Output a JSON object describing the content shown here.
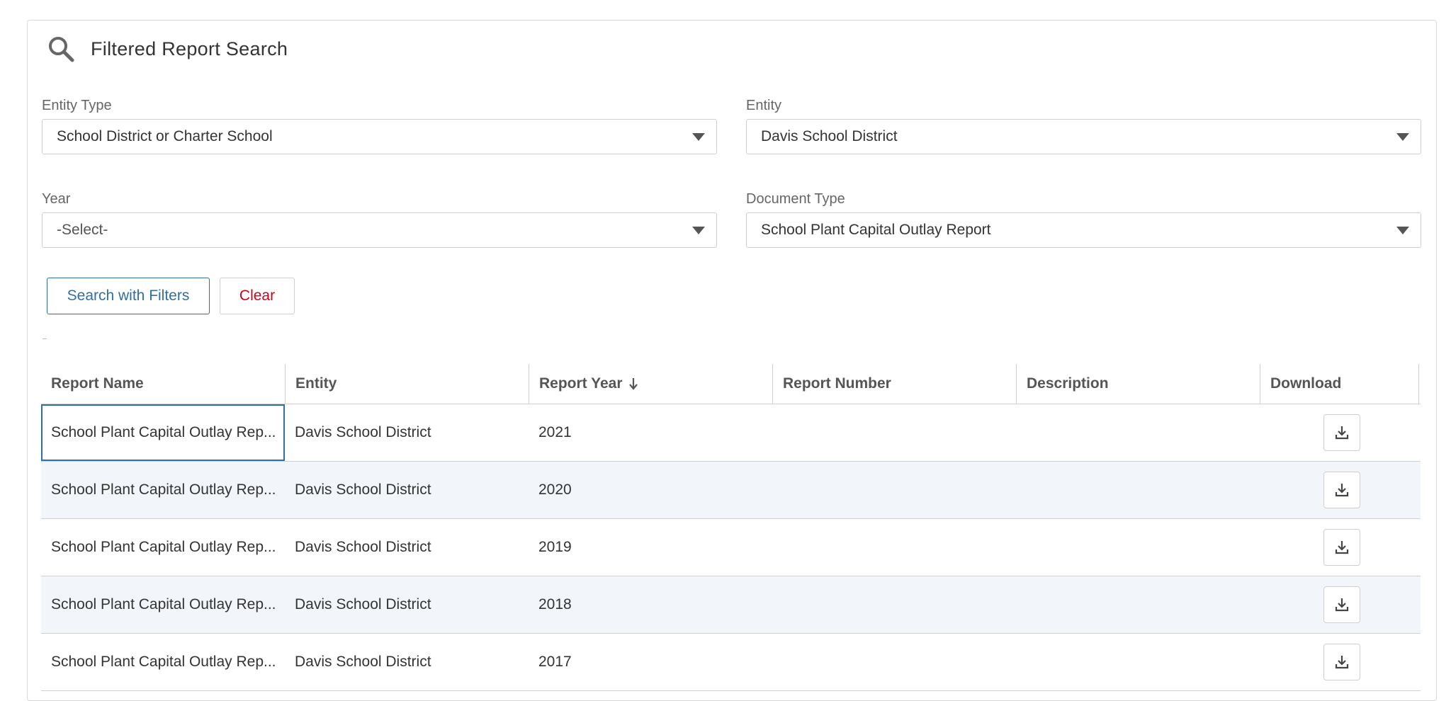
{
  "header": {
    "title": "Filtered Report Search",
    "icon": "search-icon"
  },
  "filters": {
    "entity_type": {
      "label": "Entity Type",
      "value": "School District or Charter School"
    },
    "entity": {
      "label": "Entity",
      "value": "Davis School District"
    },
    "year": {
      "label": "Year",
      "value": "-Select-"
    },
    "document_type": {
      "label": "Document Type",
      "value": "School Plant Capital Outlay Report"
    }
  },
  "buttons": {
    "search": "Search with Filters",
    "clear": "Clear"
  },
  "table": {
    "columns": [
      "Report Name",
      "Entity",
      "Report Year",
      "Report Number",
      "Description",
      "Download"
    ],
    "sort": {
      "column": "Report Year",
      "direction": "descending"
    },
    "rows": [
      {
        "name": "School Plant Capital Outlay Rep...",
        "entity": "Davis School District",
        "year": "2021",
        "number": "",
        "description": ""
      },
      {
        "name": "School Plant Capital Outlay Rep...",
        "entity": "Davis School District",
        "year": "2020",
        "number": "",
        "description": ""
      },
      {
        "name": "School Plant Capital Outlay Rep...",
        "entity": "Davis School District",
        "year": "2019",
        "number": "",
        "description": ""
      },
      {
        "name": "School Plant Capital Outlay Rep...",
        "entity": "Davis School District",
        "year": "2018",
        "number": "",
        "description": ""
      },
      {
        "name": "School Plant Capital Outlay Rep...",
        "entity": "Davis School District",
        "year": "2017",
        "number": "",
        "description": ""
      }
    ]
  },
  "colors": {
    "accent": "#2f6fa5",
    "clear": "#d0021b",
    "row_alt": "#f2f6fa"
  }
}
